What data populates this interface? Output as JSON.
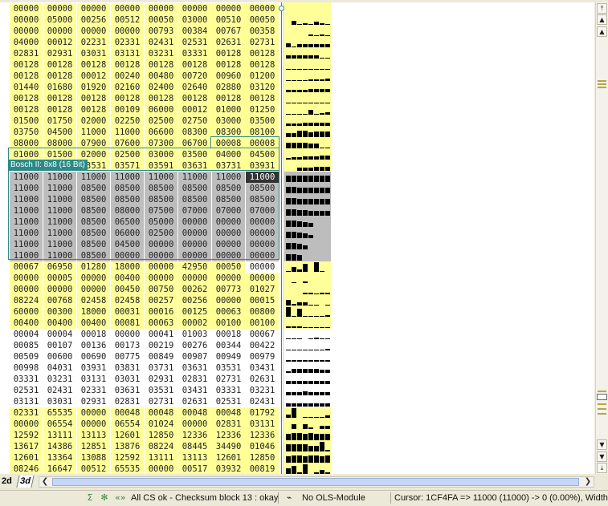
{
  "hex_rows": [
    [
      "00000",
      "00000",
      "00000",
      "00000",
      "00000",
      "00000",
      "00000",
      "00000"
    ],
    [
      "00000",
      "05000",
      "00256",
      "00512",
      "00050",
      "03000",
      "00510",
      "00050"
    ],
    [
      "00000",
      "00000",
      "00000",
      "00000",
      "00793",
      "00384",
      "00767",
      "00358"
    ],
    [
      "04000",
      "00012",
      "02231",
      "02331",
      "02431",
      "02531",
      "02631",
      "02731"
    ],
    [
      "02831",
      "02931",
      "03031",
      "03131",
      "03231",
      "03331",
      "00128",
      "00128"
    ],
    [
      "00128",
      "00128",
      "00128",
      "00128",
      "00128",
      "00128",
      "00128",
      "00128"
    ],
    [
      "00128",
      "00128",
      "00012",
      "00240",
      "00480",
      "00720",
      "00960",
      "01200"
    ],
    [
      "01440",
      "01680",
      "01920",
      "02160",
      "02400",
      "02640",
      "02880",
      "03120"
    ],
    [
      "00128",
      "00128",
      "00128",
      "00128",
      "00128",
      "00128",
      "00128",
      "00128"
    ],
    [
      "00128",
      "00128",
      "00128",
      "00109",
      "06000",
      "00012",
      "01000",
      "01250"
    ],
    [
      "01500",
      "01750",
      "02000",
      "02250",
      "02500",
      "02750",
      "03000",
      "03500"
    ],
    [
      "03750",
      "04500",
      "11000",
      "11000",
      "06600",
      "08300",
      "08300",
      "08100"
    ],
    [
      "08000",
      "08000",
      "07900",
      "07600",
      "07300",
      "06700",
      "00008",
      "00008"
    ],
    [
      "01000",
      "01500",
      "02000",
      "02500",
      "03000",
      "03500",
      "04000",
      "04500"
    ],
    [
      "",
      "",
      "03531",
      "03571",
      "03591",
      "03631",
      "03731",
      "03931"
    ],
    [
      "11000",
      "11000",
      "11000",
      "11000",
      "11000",
      "11000",
      "11000",
      "11000"
    ],
    [
      "11000",
      "11000",
      "08500",
      "08500",
      "08500",
      "08500",
      "08500",
      "08500"
    ],
    [
      "11000",
      "11000",
      "08500",
      "08500",
      "08500",
      "08500",
      "08500",
      "08500"
    ],
    [
      "11000",
      "11000",
      "08500",
      "08000",
      "07500",
      "07000",
      "07000",
      "07000"
    ],
    [
      "11000",
      "11000",
      "08500",
      "06500",
      "05000",
      "00000",
      "00000",
      "00000"
    ],
    [
      "11000",
      "11000",
      "08500",
      "06000",
      "02500",
      "00000",
      "00000",
      "00000"
    ],
    [
      "11000",
      "11000",
      "08500",
      "04500",
      "00000",
      "00000",
      "00000",
      "00000"
    ],
    [
      "11000",
      "11000",
      "08500",
      "00000",
      "00000",
      "00000",
      "00000",
      "00000"
    ],
    [
      "00067",
      "06950",
      "01280",
      "18000",
      "00000",
      "42950",
      "00050",
      "00000"
    ],
    [
      "00000",
      "00005",
      "00000",
      "00400",
      "00000",
      "00000",
      "00000",
      "00000"
    ],
    [
      "00000",
      "00000",
      "00000",
      "00450",
      "00750",
      "00262",
      "00773",
      "01027"
    ],
    [
      "08224",
      "00768",
      "02458",
      "02458",
      "00257",
      "00256",
      "00000",
      "00015"
    ],
    [
      "60000",
      "00300",
      "18000",
      "00031",
      "00016",
      "00125",
      "00063",
      "00800"
    ],
    [
      "00400",
      "00400",
      "00400",
      "00081",
      "00063",
      "00002",
      "00100",
      "00100"
    ],
    [
      "00004",
      "00004",
      "00018",
      "00000",
      "00041",
      "01003",
      "00018",
      "00067"
    ],
    [
      "00085",
      "00107",
      "00136",
      "00173",
      "00219",
      "00276",
      "00344",
      "00422"
    ],
    [
      "00509",
      "00600",
      "00690",
      "00775",
      "00849",
      "00907",
      "00949",
      "00979"
    ],
    [
      "00998",
      "04031",
      "03931",
      "03831",
      "03731",
      "03631",
      "03531",
      "03431"
    ],
    [
      "03331",
      "03231",
      "03131",
      "03031",
      "02931",
      "02831",
      "02731",
      "02631"
    ],
    [
      "02531",
      "02431",
      "02331",
      "03631",
      "03531",
      "03431",
      "03331",
      "03231"
    ],
    [
      "03131",
      "03031",
      "02931",
      "02831",
      "02731",
      "02631",
      "02531",
      "02431"
    ],
    [
      "02331",
      "65535",
      "00000",
      "00048",
      "00048",
      "00048",
      "00048",
      "01792"
    ],
    [
      "00000",
      "06554",
      "00000",
      "06554",
      "01024",
      "00000",
      "02831",
      "03131"
    ],
    [
      "12592",
      "13111",
      "13113",
      "12601",
      "12850",
      "12336",
      "12336",
      "12336"
    ],
    [
      "13617",
      "14386",
      "12851",
      "13876",
      "08224",
      "08445",
      "34490",
      "01046"
    ],
    [
      "12601",
      "13364",
      "13088",
      "12592",
      "13111",
      "13113",
      "12601",
      "12850"
    ],
    [
      "08246",
      "16647",
      "00512",
      "65535",
      "00000",
      "00517",
      "03932",
      "00819"
    ]
  ],
  "map": {
    "label": "Bosch II: 8x8 (16 Bit)"
  },
  "tabs": {
    "tab_2d": "2d",
    "tab_3d": "3d"
  },
  "status": {
    "checksum": "All CS ok - Checksum block 13 : okay",
    "ols": "No OLS-Module",
    "cursor": "Cursor: 1CF4FA => 11000 (11000) -> 0 (0.00%), Width: 8"
  },
  "colors": {
    "data_bg": "#ffff99",
    "map_gray": "#bdbdbd",
    "map_border": "#2a8a88",
    "cursor_cell": "#333333"
  },
  "icons": {
    "status_1": "sigma-icon",
    "status_2": "gear-icon",
    "status_3": "checksum-arrows-icon",
    "status_4": "ols-connector-icon"
  }
}
